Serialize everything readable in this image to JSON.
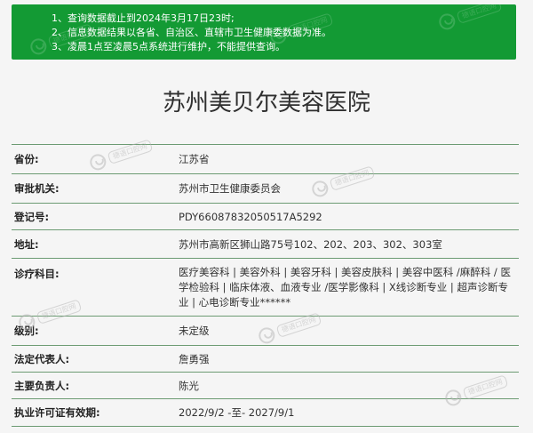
{
  "notice": {
    "lines": [
      "1、查询数据截止到2024年3月17日23时;",
      "2、信息数据结果以各省、自治区、直辖市卫生健康委数据为准。",
      "3、凌晨1点至凌晨5点系统进行维护，不能提供查询。"
    ],
    "background": "#139a34"
  },
  "hospital": {
    "name": "苏州美贝尔美容医院"
  },
  "info": [
    {
      "label": "省份:",
      "value": "江苏省"
    },
    {
      "label": "审批机关:",
      "value": "苏州市卫生健康委员会"
    },
    {
      "label": "登记号:",
      "value": "PDY66087832050517A5292"
    },
    {
      "label": "地址:",
      "value": "苏州市高新区狮山路75号102、202、203、302、303室"
    },
    {
      "label": "诊疗科目:",
      "value": "医疗美容科 | 美容外科 | 美容牙科 | 美容皮肤科 | 美容中医科 /麻醉科 / 医学检验科 | 临床体液、血液专业 /医学影像科 | X线诊断专业 | 超声诊断专业 | 心电诊断专业******"
    },
    {
      "label": "级别:",
      "value": "未定级"
    },
    {
      "label": "法定代表人:",
      "value": "詹勇强"
    },
    {
      "label": "主要负责人:",
      "value": "陈光"
    },
    {
      "label": "执业许可证有效期:",
      "value": "2022/9/2 -至- 2027/9/1"
    }
  ],
  "watermark": {
    "text": "德语口腔网",
    "icon": "tooth-icon"
  },
  "colors": {
    "row_border": "#6c9b73",
    "page_background": "#f5f5f5"
  }
}
